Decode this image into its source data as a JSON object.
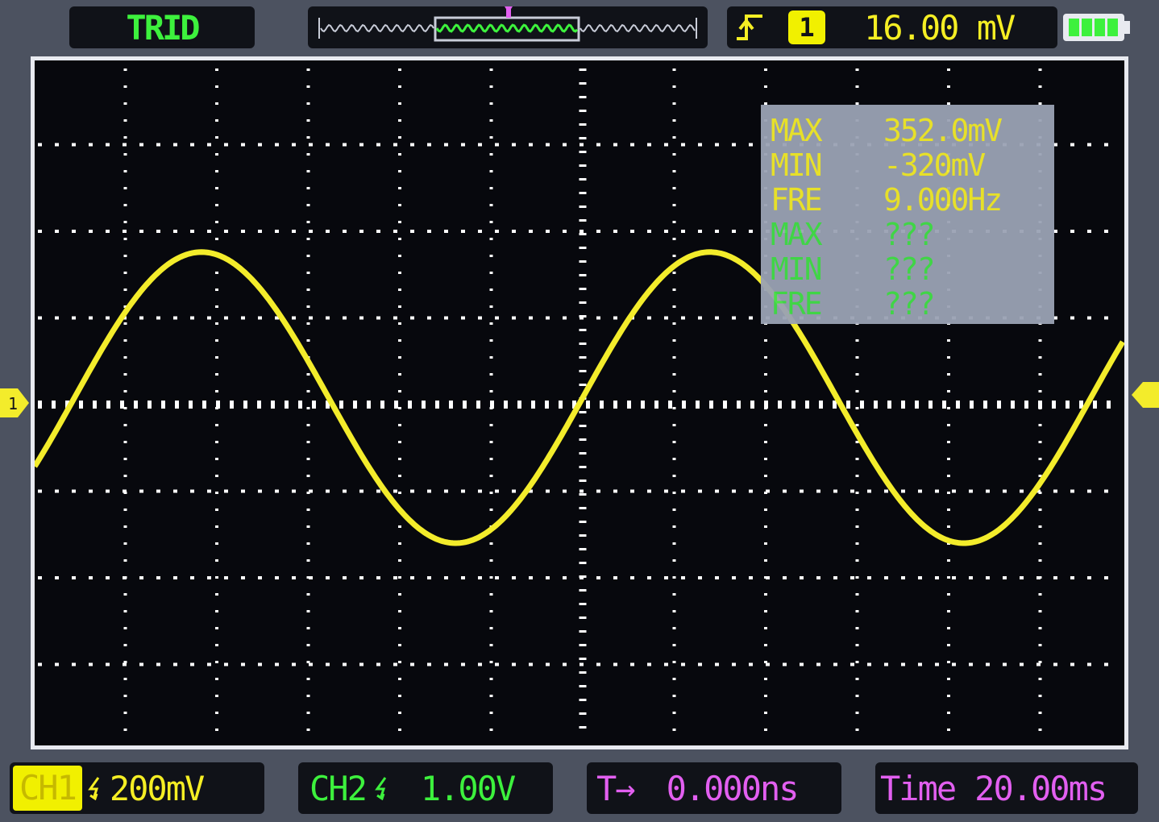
{
  "header": {
    "trigger_status": "TRID",
    "trigger_channel": "1",
    "trigger_level": "16.00 mV",
    "trigger_edge_icon": "rising-edge-icon",
    "battery_icon": "battery-icon"
  },
  "measurements": {
    "ch1": [
      {
        "label": "MAX",
        "value": "352.0mV"
      },
      {
        "label": "MIN",
        "value": "-320mV"
      },
      {
        "label": "FRE",
        "value": "9.000Hz"
      }
    ],
    "ch2": [
      {
        "label": "MAX",
        "value": "???"
      },
      {
        "label": "MIN",
        "value": "???"
      },
      {
        "label": "FRE",
        "value": "???"
      }
    ]
  },
  "footer": {
    "ch1": {
      "label": "CH1",
      "scale": "200mV"
    },
    "ch2": {
      "label": "CH2",
      "scale": "1.00V"
    },
    "trigger_position": {
      "label": "T→",
      "value": "0.000ns"
    },
    "timebase": {
      "label": "Time",
      "value": "20.00ms"
    }
  },
  "colors": {
    "ch1": "#f3ec2b",
    "ch2": "#3df13d",
    "time": "#e25ff0",
    "screen_bg": "#07080d",
    "bezel": "#4c5260"
  },
  "waveform": {
    "channel": "CH1",
    "shape": "sine",
    "frequency_hz": 9.0,
    "max_mv": 352.0,
    "min_mv": -320,
    "volts_per_div_mv": 200,
    "time_per_div_ms": 20.0
  }
}
